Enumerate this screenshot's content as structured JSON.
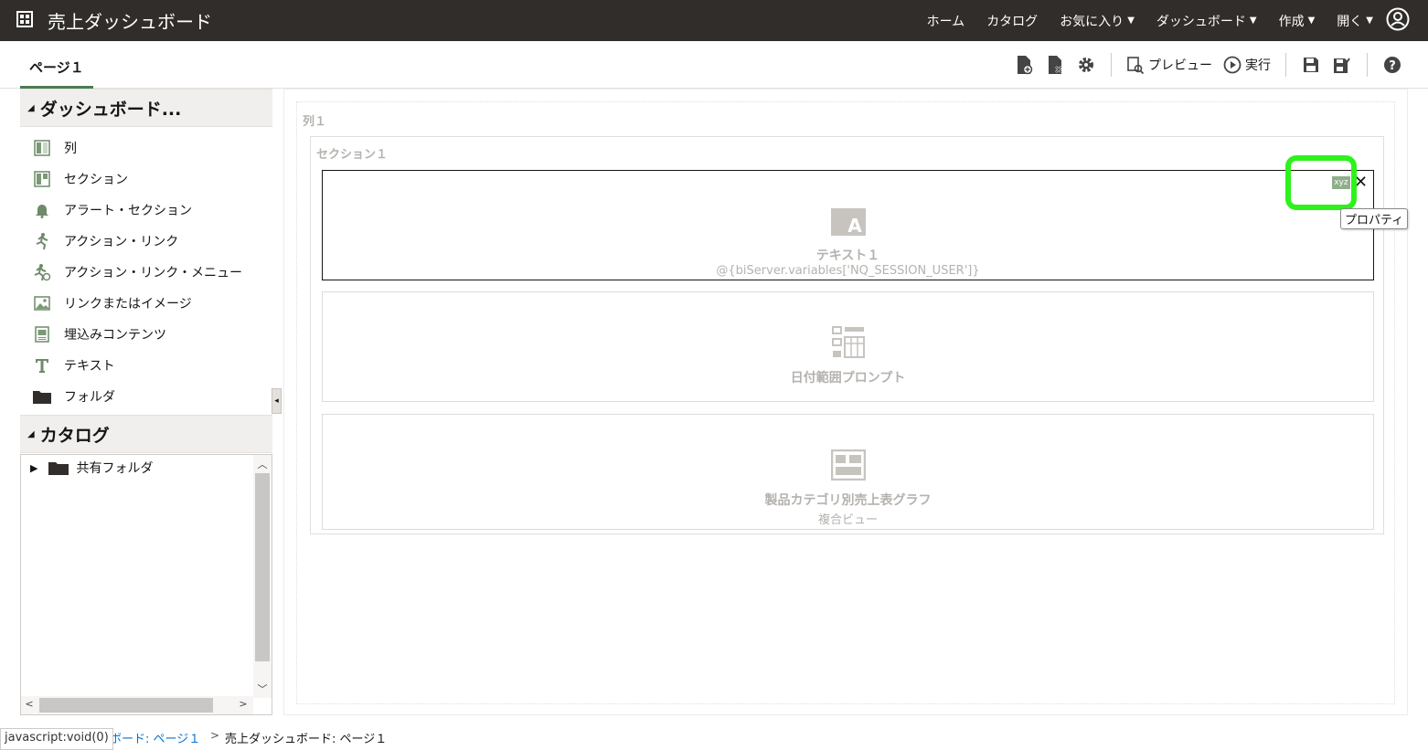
{
  "app": {
    "title": "売上ダッシュボード",
    "nav": [
      {
        "label": "ホーム",
        "dropdown": false
      },
      {
        "label": "カタログ",
        "dropdown": false
      },
      {
        "label": "お気に入り",
        "dropdown": true
      },
      {
        "label": "ダッシュボード",
        "dropdown": true
      },
      {
        "label": "作成",
        "dropdown": true
      },
      {
        "label": "開く",
        "dropdown": true
      }
    ]
  },
  "page_tab": "ページ１",
  "toolbar": {
    "preview_label": "プレビュー",
    "run_label": "実行"
  },
  "objects_panel": {
    "title": "ダッシュボード...",
    "items": [
      {
        "label": "列",
        "icon": "column-icon"
      },
      {
        "label": "セクション",
        "icon": "section-icon"
      },
      {
        "label": "アラート・セクション",
        "icon": "bell-icon"
      },
      {
        "label": "アクション・リンク",
        "icon": "action-link-icon"
      },
      {
        "label": "アクション・リンク・メニュー",
        "icon": "action-link-menu-icon"
      },
      {
        "label": "リンクまたはイメージ",
        "icon": "image-icon"
      },
      {
        "label": "埋込みコンテンツ",
        "icon": "embedded-content-icon"
      },
      {
        "label": "テキスト",
        "icon": "text-icon"
      },
      {
        "label": "フォルダ",
        "icon": "folder-icon"
      }
    ]
  },
  "catalog_panel": {
    "title": "カタログ",
    "tree": [
      {
        "label": "共有フォルダ"
      }
    ]
  },
  "canvas": {
    "column_label": "列１",
    "section_label": "セクション１",
    "views": [
      {
        "title": "テキスト１",
        "subtitle": "@{biServer.variables['NQ_SESSION_USER']}"
      },
      {
        "title": "日付範囲プロンプト",
        "subtitle": ""
      },
      {
        "title": "製品カテゴリ別売上表グラフ",
        "subtitle": "複合ビュー"
      }
    ],
    "xyz_label": "xyz",
    "tooltip": "プロパティ"
  },
  "status_bar": {
    "link_text": "javascript:void(0)",
    "breadcrumb_link": "ボード: ページ１",
    "separator": ">",
    "breadcrumb_current": "売上ダッシュボード: ページ１"
  },
  "colors": {
    "topbar": "#312d2a",
    "accent": "#4a7d52",
    "highlight": "#2ef21b"
  }
}
